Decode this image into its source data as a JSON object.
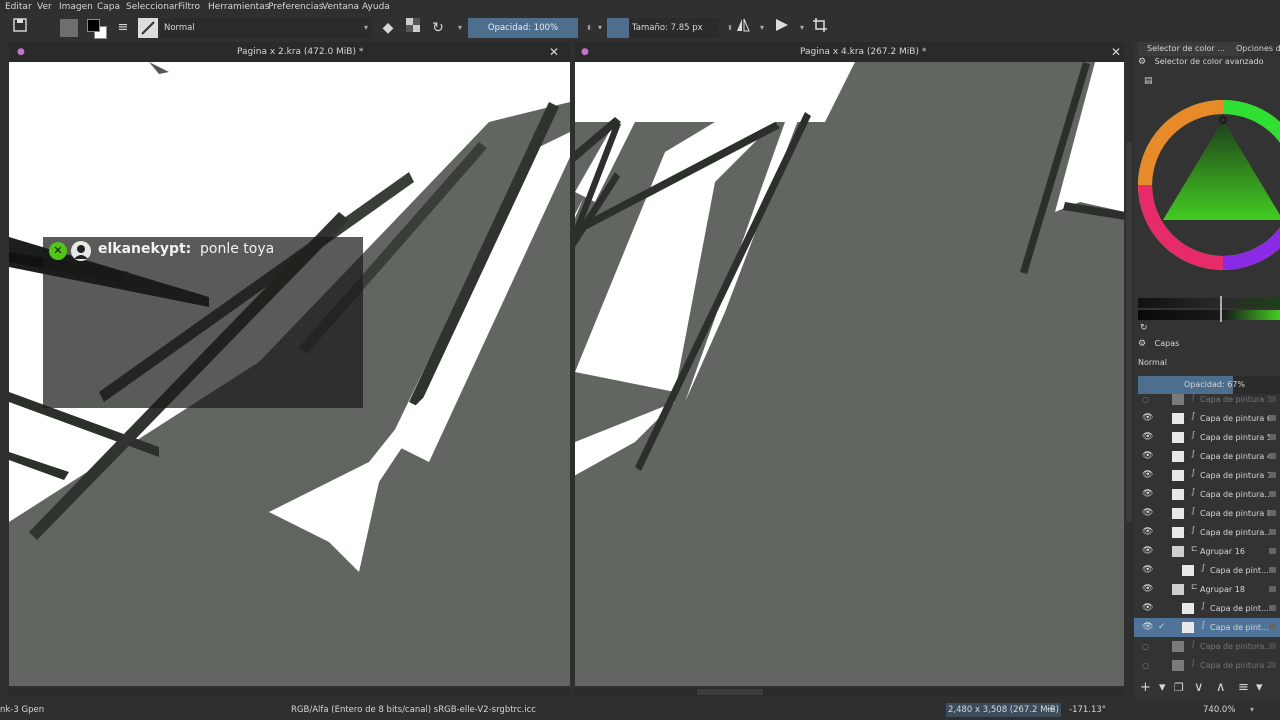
{
  "menu": [
    "Editar",
    "Ver",
    "Imagen",
    "Capa",
    "Seleccionar",
    "Filtro",
    "Herramientas",
    "Preferencias",
    "Ventana",
    "Ayuda"
  ],
  "toolbar": {
    "blend_mode": "Normal",
    "opacity_label": "Opacidad: 100%",
    "opacity_value": 100,
    "size_label": "Tamaño: 7.85 px"
  },
  "tabs": {
    "left_title": "Pagina x 2.kra (472.0 MiB) *",
    "right_title": "Pagina x 4.kra (267.2 MiB) *"
  },
  "chat": {
    "username": "elkanekypt:",
    "message": "ponle toya"
  },
  "dock": {
    "tab1": "Selector de color ...",
    "tab2": "Opciones de",
    "color_selector_title": "Selector de color avanzado",
    "layers_title": "Capas",
    "layer_blend": "Normal",
    "layer_opacity_label": "Opacidad:  67%",
    "layer_opacity_value": 67,
    "layers": [
      {
        "name": "Capa de pintura 3",
        "visible": false,
        "kind": "layer",
        "indent": 0,
        "selected": false,
        "faded": true
      },
      {
        "name": "Capa de pintura 6",
        "visible": true,
        "kind": "layer",
        "indent": 0,
        "selected": false,
        "faded": false
      },
      {
        "name": "Capa de pintura 5",
        "visible": true,
        "kind": "layer",
        "indent": 0,
        "selected": false,
        "faded": false
      },
      {
        "name": "Capa de pintura 4",
        "visible": true,
        "kind": "layer",
        "indent": 0,
        "selected": false,
        "faded": false
      },
      {
        "name": "Capa de pintura 7",
        "visible": true,
        "kind": "layer",
        "indent": 0,
        "selected": false,
        "faded": false
      },
      {
        "name": "Capa de pintura...",
        "visible": true,
        "kind": "layer",
        "indent": 0,
        "selected": false,
        "faded": false
      },
      {
        "name": "Capa de pintura 8",
        "visible": true,
        "kind": "layer",
        "indent": 0,
        "selected": false,
        "faded": false
      },
      {
        "name": "Capa de pintura...",
        "visible": true,
        "kind": "layer",
        "indent": 0,
        "selected": false,
        "faded": false
      },
      {
        "name": "Agrupar 16",
        "visible": true,
        "kind": "group",
        "indent": 0,
        "selected": false,
        "faded": false
      },
      {
        "name": "Capa de pint...",
        "visible": true,
        "kind": "layer",
        "indent": 1,
        "selected": false,
        "faded": false
      },
      {
        "name": "Agrupar 18",
        "visible": true,
        "kind": "group",
        "indent": 0,
        "selected": false,
        "faded": false
      },
      {
        "name": "Capa de pint...",
        "visible": true,
        "kind": "layer",
        "indent": 1,
        "selected": false,
        "faded": false
      },
      {
        "name": "Capa de pint...",
        "visible": true,
        "kind": "layer",
        "indent": 1,
        "selected": true,
        "faded": false
      },
      {
        "name": "Capa de pintura...",
        "visible": false,
        "kind": "layer",
        "indent": 0,
        "selected": false,
        "faded": true
      },
      {
        "name": "Capa de pintura 2",
        "visible": false,
        "kind": "layer",
        "indent": 0,
        "selected": false,
        "faded": true
      }
    ]
  },
  "status": {
    "brush": "nk-3 Gpen",
    "color_space": "RGB/Alfa (Entero de 8 bits/canal)  sRGB-elle-V2-srgbtrc.icc",
    "dimensions": "2,480 x 3,508 (267.2 MiB)",
    "rotation": "-171.13°",
    "zoom": "740.0%"
  },
  "colors": {
    "canvas_gray": "#626660",
    "selection_blue": "#4f7399",
    "opacity_blue": "#4e6e8e",
    "chat_green": "#52c41a"
  }
}
